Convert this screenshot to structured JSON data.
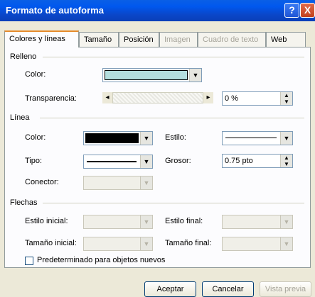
{
  "window": {
    "title": "Formato de autoforma",
    "help": "?",
    "close": "X"
  },
  "tabs": [
    {
      "label": "Colores y líneas",
      "active": true,
      "disabled": false
    },
    {
      "label": "Tamaño",
      "active": false,
      "disabled": false
    },
    {
      "label": "Posición",
      "active": false,
      "disabled": false
    },
    {
      "label": "Imagen",
      "active": false,
      "disabled": true
    },
    {
      "label": "Cuadro de texto",
      "active": false,
      "disabled": true
    },
    {
      "label": "Web",
      "active": false,
      "disabled": false
    }
  ],
  "relleno": {
    "heading": "Relleno",
    "color_label": "Color:",
    "color_value": "#b4dede",
    "transparencia_label": "Transparencia:",
    "transparencia_value": "0 %"
  },
  "linea": {
    "heading": "Línea",
    "color_label": "Color:",
    "estilo_label": "Estilo:",
    "tipo_label": "Tipo:",
    "grosor_label": "Grosor:",
    "grosor_value": "0.75 pto",
    "conector_label": "Conector:"
  },
  "flechas": {
    "heading": "Flechas",
    "estilo_inicial_label": "Estilo inicial:",
    "estilo_final_label": "Estilo final:",
    "tamano_inicial_label": "Tamaño inicial:",
    "tamano_final_label": "Tamaño final:"
  },
  "predeterminado_label": "Predeterminado para objetos nuevos",
  "buttons": {
    "aceptar": "Aceptar",
    "cancelar": "Cancelar",
    "vista_previa": "Vista previa"
  }
}
